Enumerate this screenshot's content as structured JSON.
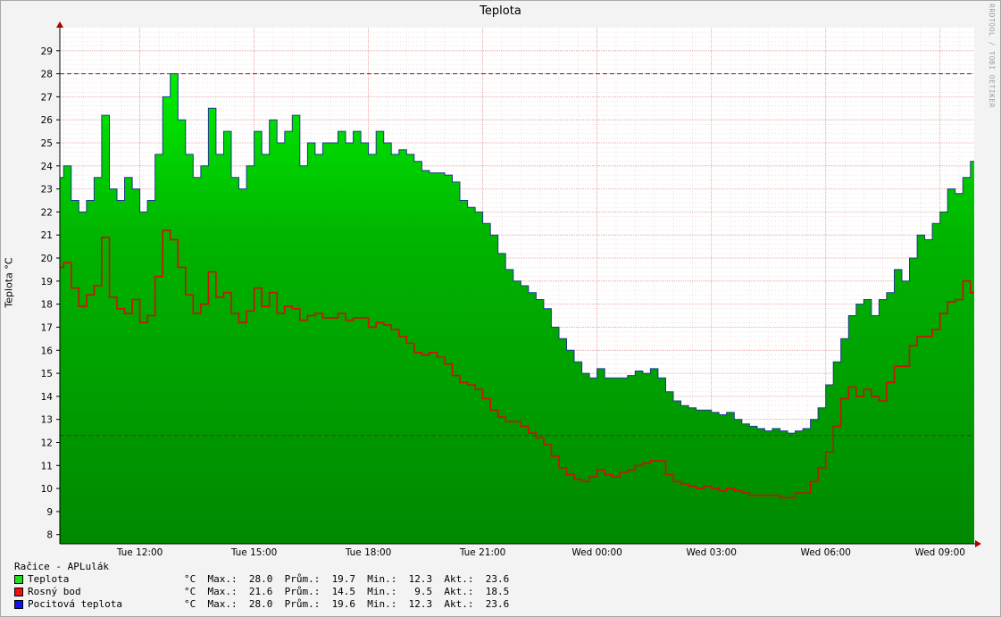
{
  "chart_data": {
    "type": "area",
    "title": "Teplota",
    "ylabel": "Teplota °C",
    "watermark": "RRDTOOL / TOBI OETIKER",
    "ylim": [
      7.6,
      30
    ],
    "yticks": [
      8,
      9,
      10,
      11,
      12,
      13,
      14,
      15,
      16,
      17,
      18,
      19,
      20,
      21,
      22,
      23,
      24,
      25,
      26,
      27,
      28,
      29
    ],
    "xticks": [
      "Tue 12:00",
      "Tue 15:00",
      "Tue 18:00",
      "Tue 21:00",
      "Wed 00:00",
      "Wed 03:00",
      "Wed 06:00",
      "Wed 09:00"
    ],
    "hrules": [
      28.0,
      12.3
    ],
    "hours": [
      9.9,
      10.0,
      10.2,
      10.4,
      10.6,
      10.8,
      11.0,
      11.2,
      11.4,
      11.6,
      11.8,
      12.0,
      12.2,
      12.4,
      12.6,
      12.8,
      13.0,
      13.2,
      13.4,
      13.6,
      13.8,
      14.0,
      14.2,
      14.4,
      14.6,
      14.8,
      15.0,
      15.2,
      15.4,
      15.6,
      15.8,
      16.0,
      16.2,
      16.4,
      16.6,
      16.8,
      17.0,
      17.2,
      17.4,
      17.6,
      17.8,
      18.0,
      18.2,
      18.4,
      18.6,
      18.8,
      19.0,
      19.2,
      19.4,
      19.6,
      19.8,
      20.0,
      20.2,
      20.4,
      20.6,
      20.8,
      21.0,
      21.2,
      21.4,
      21.6,
      21.8,
      22.0,
      22.2,
      22.4,
      22.6,
      22.8,
      23.0,
      23.2,
      23.4,
      23.6,
      23.8,
      24.0,
      24.2,
      24.4,
      24.6,
      24.8,
      25.0,
      25.2,
      25.4,
      25.6,
      25.8,
      26.0,
      26.2,
      26.4,
      26.6,
      26.8,
      27.0,
      27.2,
      27.4,
      27.6,
      27.8,
      28.0,
      28.2,
      28.4,
      28.6,
      28.8,
      29.0,
      29.2,
      29.4,
      29.6,
      29.8,
      30.0,
      30.2,
      30.4,
      30.6,
      30.8,
      31.0,
      31.2,
      31.4,
      31.6,
      31.8,
      32.0,
      32.2,
      32.4,
      32.6,
      32.8,
      33.0,
      33.2,
      33.4,
      33.6,
      33.8
    ],
    "series": [
      {
        "name": "Teplota",
        "color": "#00cc00",
        "values": [
          23.5,
          24.0,
          22.5,
          22.0,
          22.5,
          23.5,
          26.2,
          23.0,
          22.5,
          23.5,
          23.0,
          22.0,
          22.5,
          24.5,
          27.0,
          28.0,
          26.0,
          24.5,
          23.5,
          24.0,
          26.5,
          24.5,
          25.5,
          23.5,
          23.0,
          24.0,
          25.5,
          24.5,
          26.0,
          25.0,
          25.5,
          26.2,
          24.0,
          25.0,
          24.5,
          25.0,
          25.0,
          25.5,
          25.0,
          25.5,
          25.0,
          24.5,
          25.5,
          25.0,
          24.5,
          24.7,
          24.5,
          24.2,
          23.8,
          23.7,
          23.7,
          23.6,
          23.3,
          22.5,
          22.2,
          22.0,
          21.5,
          21.0,
          20.2,
          19.5,
          19.0,
          18.8,
          18.5,
          18.2,
          17.8,
          17.0,
          16.5,
          16.0,
          15.5,
          15.0,
          14.8,
          15.2,
          14.8,
          14.8,
          14.8,
          14.9,
          15.1,
          15.0,
          15.2,
          14.8,
          14.2,
          13.8,
          13.6,
          13.5,
          13.4,
          13.4,
          13.3,
          13.2,
          13.3,
          13.0,
          12.8,
          12.7,
          12.6,
          12.5,
          12.6,
          12.5,
          12.4,
          12.5,
          12.6,
          13.0,
          13.5,
          14.5,
          15.5,
          16.5,
          17.5,
          18.0,
          18.2,
          17.5,
          18.2,
          18.5,
          19.5,
          19.0,
          20.0,
          21.0,
          20.8,
          21.5,
          22.0,
          23.0,
          22.8,
          23.5,
          24.2
        ]
      },
      {
        "name": "Rosný bod",
        "color": "#ff0000",
        "values": [
          19.6,
          19.8,
          18.7,
          17.9,
          18.4,
          18.8,
          20.9,
          18.3,
          17.8,
          17.6,
          18.2,
          17.2,
          17.5,
          19.2,
          21.2,
          20.8,
          19.6,
          18.4,
          17.6,
          18.0,
          19.4,
          18.3,
          18.5,
          17.6,
          17.2,
          17.7,
          18.7,
          17.9,
          18.5,
          17.6,
          17.9,
          17.8,
          17.3,
          17.5,
          17.6,
          17.4,
          17.4,
          17.6,
          17.3,
          17.4,
          17.4,
          17.0,
          17.2,
          17.1,
          16.9,
          16.6,
          16.3,
          15.9,
          15.8,
          15.9,
          15.7,
          15.4,
          14.9,
          14.6,
          14.5,
          14.3,
          13.9,
          13.4,
          13.1,
          12.9,
          12.9,
          12.7,
          12.4,
          12.2,
          11.9,
          11.4,
          10.9,
          10.6,
          10.4,
          10.3,
          10.5,
          10.8,
          10.6,
          10.5,
          10.7,
          10.8,
          11.0,
          11.1,
          11.2,
          11.2,
          10.6,
          10.3,
          10.2,
          10.1,
          10.0,
          10.1,
          10.0,
          9.9,
          10.0,
          9.9,
          9.8,
          9.7,
          9.7,
          9.7,
          9.7,
          9.6,
          9.6,
          9.8,
          9.8,
          10.3,
          10.9,
          11.6,
          12.7,
          13.9,
          14.4,
          14.0,
          14.3,
          14.0,
          13.8,
          14.6,
          15.3,
          15.3,
          16.2,
          16.6,
          16.6,
          16.9,
          17.6,
          18.1,
          18.2,
          19.0,
          18.5
        ]
      },
      {
        "name": "Pocitová teplota",
        "color": "#0000ff",
        "values": [
          23.5,
          24.0,
          22.5,
          22.0,
          22.5,
          23.5,
          26.2,
          23.0,
          22.5,
          23.5,
          23.0,
          22.0,
          22.5,
          24.5,
          27.0,
          28.0,
          26.0,
          24.5,
          23.5,
          24.0,
          26.5,
          24.5,
          25.5,
          23.5,
          23.0,
          24.0,
          25.5,
          24.5,
          26.0,
          25.0,
          25.5,
          26.2,
          24.0,
          25.0,
          24.5,
          25.0,
          25.0,
          25.5,
          25.0,
          25.5,
          25.0,
          24.5,
          25.5,
          25.0,
          24.5,
          24.7,
          24.5,
          24.2,
          23.8,
          23.7,
          23.7,
          23.6,
          23.3,
          22.5,
          22.2,
          22.0,
          21.5,
          21.0,
          20.2,
          19.5,
          19.0,
          18.8,
          18.5,
          18.2,
          17.8,
          17.0,
          16.5,
          16.0,
          15.5,
          15.0,
          14.8,
          15.2,
          14.8,
          14.8,
          14.8,
          14.9,
          15.1,
          15.0,
          15.2,
          14.8,
          14.2,
          13.8,
          13.6,
          13.5,
          13.4,
          13.4,
          13.3,
          13.2,
          13.3,
          13.0,
          12.8,
          12.7,
          12.6,
          12.5,
          12.6,
          12.5,
          12.4,
          12.5,
          12.6,
          13.0,
          13.5,
          14.5,
          15.5,
          16.5,
          17.5,
          18.0,
          18.2,
          17.5,
          18.2,
          18.5,
          19.5,
          19.0,
          20.0,
          21.0,
          20.8,
          21.5,
          22.0,
          23.0,
          22.8,
          23.5,
          24.2
        ]
      }
    ]
  },
  "legend": {
    "station": "Račice - APLulák",
    "rows": [
      {
        "name": "Teplota",
        "color": "#22dd22",
        "stats": "°C  Max.:  28.0  Prům.:  19.7  Min.:  12.3  Akt.:  23.6"
      },
      {
        "name": "Rosný bod",
        "color": "#ee1111",
        "stats": "°C  Max.:  21.6  Prům.:  14.5  Min.:   9.5  Akt.:  18.5"
      },
      {
        "name": "Pocitová teplota",
        "color": "#1111ee",
        "stats": "°C  Max.:  28.0  Prům.:  19.6  Min.:  12.3  Akt.:  23.6"
      }
    ]
  }
}
